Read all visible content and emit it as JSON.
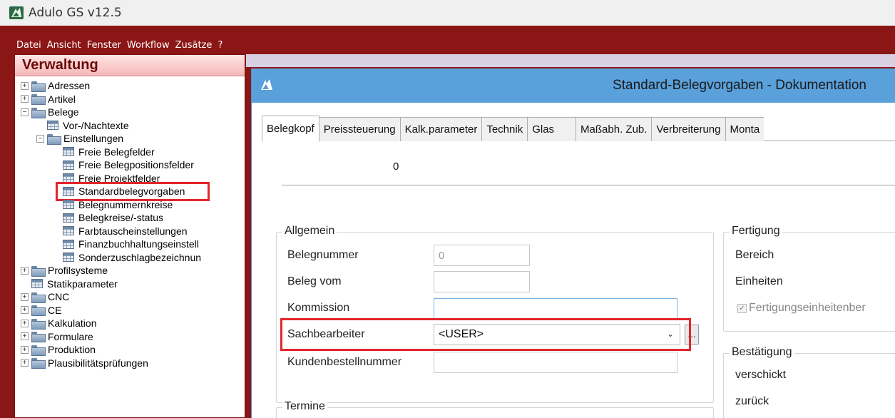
{
  "app": {
    "title": "Adulo GS v12.5"
  },
  "menu": [
    "Datei",
    "Ansicht",
    "Fenster",
    "Workflow",
    "Zusätze",
    "?"
  ],
  "verwaltung": {
    "title": "Verwaltung",
    "tree": [
      {
        "label": "Adressen",
        "type": "folder",
        "level": 0,
        "expander": "+"
      },
      {
        "label": "Artikel",
        "type": "folder",
        "level": 0,
        "expander": "+"
      },
      {
        "label": "Belege",
        "type": "folder",
        "level": 0,
        "expander": "−"
      },
      {
        "label": "Vor-/Nachtexte",
        "type": "table",
        "level": 1
      },
      {
        "label": "Einstellungen",
        "type": "folder",
        "level": 1,
        "expander": "−"
      },
      {
        "label": "Freie Belegfelder",
        "type": "table",
        "level": 2
      },
      {
        "label": "Freie Belegpositionsfelder",
        "type": "table",
        "level": 2
      },
      {
        "label": "Freie Projektfelder",
        "type": "table",
        "level": 2
      },
      {
        "label": "Standardbelegvorgaben",
        "type": "table",
        "level": 2,
        "highlighted": true
      },
      {
        "label": "Belegnummernkreise",
        "type": "table",
        "level": 2
      },
      {
        "label": "Belegkreise/-status",
        "type": "table",
        "level": 2
      },
      {
        "label": "Farbtauscheinstellungen",
        "type": "table",
        "level": 2
      },
      {
        "label": "Finanzbuchhaltungseinstell",
        "type": "table",
        "level": 2
      },
      {
        "label": "Sonderzuschlagbezeichnun",
        "type": "table",
        "level": 2
      },
      {
        "label": "Profilsysteme",
        "type": "folder",
        "level": 0,
        "expander": "+"
      },
      {
        "label": "Statikparameter",
        "type": "table",
        "level": 0
      },
      {
        "label": "CNC",
        "type": "folder",
        "level": 0,
        "expander": "+"
      },
      {
        "label": "CE",
        "type": "folder",
        "level": 0,
        "expander": "+"
      },
      {
        "label": "Kalkulation",
        "type": "folder",
        "level": 0,
        "expander": "+"
      },
      {
        "label": "Formulare",
        "type": "folder",
        "level": 0,
        "expander": "+"
      },
      {
        "label": "Produktion",
        "type": "folder",
        "level": 0,
        "expander": "+"
      },
      {
        "label": "Plausibilitätsprüfungen",
        "type": "folder",
        "level": 0,
        "expander": "+"
      }
    ]
  },
  "dialog": {
    "title": "Standard-Belegvorgaben - Dokumentation",
    "tabs": [
      "Belegkopf",
      "Preissteuerung",
      "Kalk.parameter",
      "Technik",
      "Glas",
      "Maßabh. Zub.",
      "Verbreiterung",
      "Monta"
    ],
    "active_tab": "Belegkopf",
    "header_value": "0",
    "allgemein": {
      "title": "Allgemein",
      "belegnummer_label": "Belegnummer",
      "belegnummer_value": "0",
      "beleg_vom_label": "Beleg vom",
      "beleg_vom_value": "",
      "kommission_label": "Kommission",
      "kommission_value": "",
      "sachbearbeiter_label": "Sachbearbeiter",
      "sachbearbeiter_value": "<USER>",
      "ellipsis": "...",
      "kundenbestellnummer_label": "Kundenbestellnummer",
      "kundenbestellnummer_value": ""
    },
    "termine": {
      "title": "Termine"
    },
    "fertigung": {
      "title": "Fertigung",
      "bereich_label": "Bereich",
      "einheiten_label": "Einheiten",
      "checkbox_label": "Fertigungseinheitenber",
      "checkbox_checked": true
    },
    "bestaetigung": {
      "title": "Bestätigung",
      "verschickt_label": "verschickt",
      "zurueck_label": "zurück"
    }
  },
  "colors": {
    "mdi_background": "#8b1616",
    "dialog_titlebar": "#5aa0db",
    "highlight": "#e3262c"
  }
}
